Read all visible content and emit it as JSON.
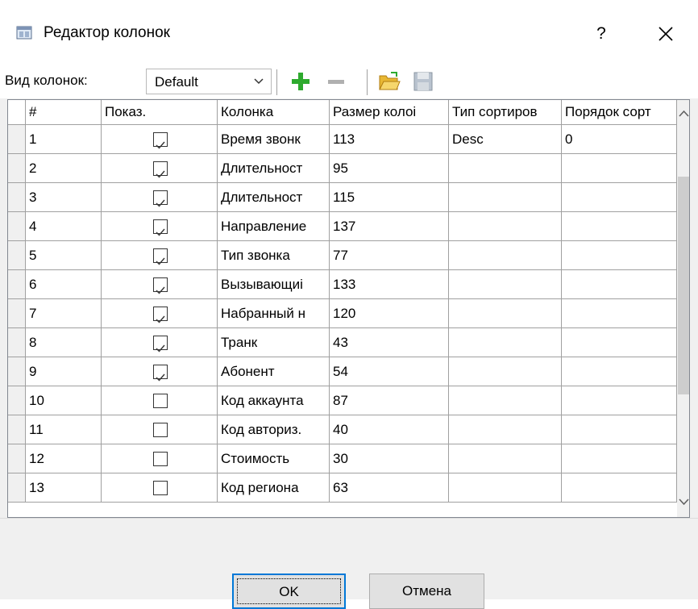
{
  "window": {
    "title": "Редактор колонок",
    "help": "?"
  },
  "toolbar": {
    "view_label": "Вид колонок:",
    "view_value": "Default"
  },
  "colors": {
    "accent": "#0078d7",
    "add": "#2eaa2e"
  },
  "table": {
    "headers": [
      "#",
      "Показ.",
      "Колонка",
      "Размер колоі",
      "Тип сортиров",
      "Порядок сорт"
    ],
    "rows": [
      {
        "n": "1",
        "show": true,
        "col": "Время звонк",
        "size": "113",
        "sort": "Desc",
        "order": "0"
      },
      {
        "n": "2",
        "show": true,
        "col": "Длительност",
        "size": "95",
        "sort": "",
        "order": ""
      },
      {
        "n": "3",
        "show": true,
        "col": "Длительност",
        "size": "115",
        "sort": "",
        "order": ""
      },
      {
        "n": "4",
        "show": true,
        "col": "Направление",
        "size": "137",
        "sort": "",
        "order": ""
      },
      {
        "n": "5",
        "show": true,
        "col": "Тип звонка",
        "size": "77",
        "sort": "",
        "order": ""
      },
      {
        "n": "6",
        "show": true,
        "col": "Вызывающиі",
        "size": "133",
        "sort": "",
        "order": ""
      },
      {
        "n": "7",
        "show": true,
        "col": "Набранный н",
        "size": "120",
        "sort": "",
        "order": ""
      },
      {
        "n": "8",
        "show": true,
        "col": "Транк",
        "size": "43",
        "sort": "",
        "order": ""
      },
      {
        "n": "9",
        "show": true,
        "col": "Абонент",
        "size": "54",
        "sort": "",
        "order": ""
      },
      {
        "n": "10",
        "show": false,
        "col": "Код аккаунта",
        "size": "87",
        "sort": "",
        "order": ""
      },
      {
        "n": "11",
        "show": false,
        "col": "Код авториз.",
        "size": "40",
        "sort": "",
        "order": ""
      },
      {
        "n": "12",
        "show": false,
        "col": "Стоимость",
        "size": "30",
        "sort": "",
        "order": ""
      },
      {
        "n": "13",
        "show": false,
        "col": "Код региона",
        "size": "63",
        "sort": "",
        "order": ""
      }
    ]
  },
  "buttons": {
    "ok": "OK",
    "cancel": "Отмена"
  }
}
